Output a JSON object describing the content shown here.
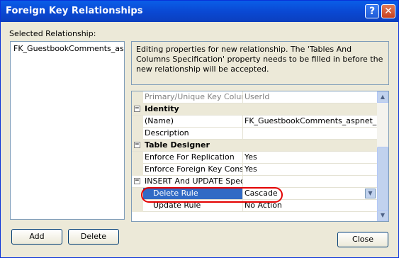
{
  "window": {
    "title": "Foreign Key Relationships",
    "help_glyph": "?",
    "close_glyph": "✕"
  },
  "left": {
    "label": "Selected Relationship:",
    "items": [
      "FK_GuestbookComments_aspnet"
    ]
  },
  "info": {
    "text": "Editing properties for new relationship.  The 'Tables And Columns Specification' property needs to be filled in before the new relationship will be accepted."
  },
  "grid": {
    "rows": [
      {
        "name": "Primary/Unique Key Colun",
        "value": "UserId"
      },
      {
        "category": "Identity"
      },
      {
        "name": "(Name)",
        "value": "FK_GuestbookComments_aspnet_Users"
      },
      {
        "name": "Description",
        "value": ""
      },
      {
        "category": "Table Designer"
      },
      {
        "name": "Enforce For Replication",
        "value": "Yes"
      },
      {
        "name": "Enforce Foreign Key Constra",
        "value": "Yes"
      },
      {
        "name": "INSERT And UPDATE Specific",
        "value": ""
      },
      {
        "name": "Delete Rule",
        "value": "Cascade"
      },
      {
        "name": "Update Rule",
        "value": "No Action"
      }
    ],
    "expander": "−"
  },
  "buttons": {
    "add": "Add",
    "delete": "Delete",
    "close": "Close"
  },
  "scroll_glyphs": {
    "up": "▲",
    "down": "▼"
  }
}
